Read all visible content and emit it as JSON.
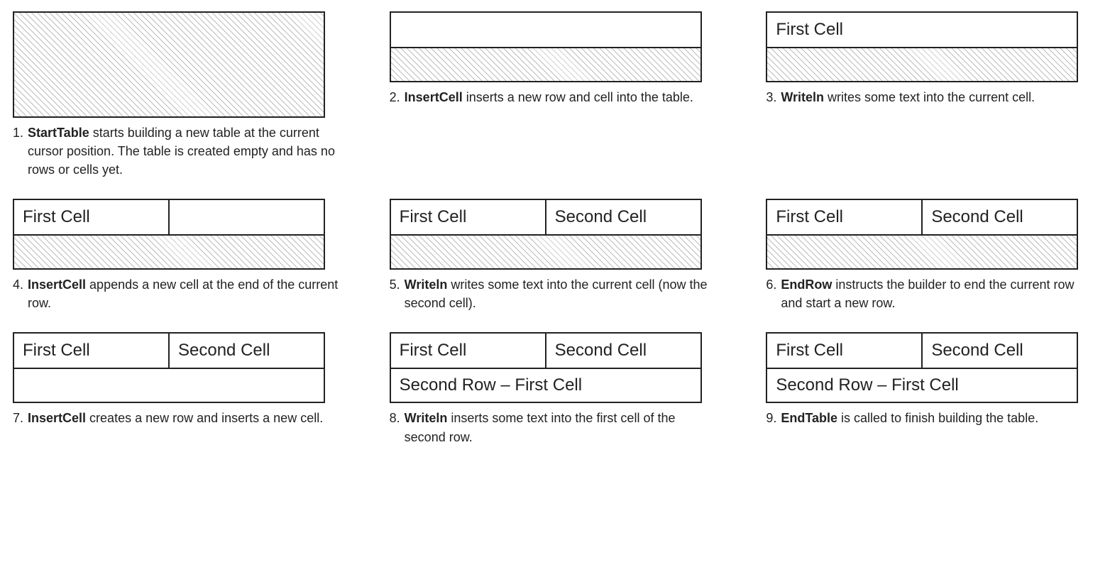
{
  "cells": {
    "first": "First Cell",
    "second": "Second Cell",
    "row2first": "Second Row – First Cell"
  },
  "steps": [
    {
      "num": "1.",
      "bold": "StartTable",
      "rest": " starts building a new table at the current cursor position.",
      "extra": "The table is created empty and has no rows or cells yet."
    },
    {
      "num": "2.",
      "bold": "InsertCell",
      "rest": " inserts a new row and cell into the table."
    },
    {
      "num": "3.",
      "bold": "Writeln",
      "rest": " writes some text into the current cell."
    },
    {
      "num": "4.",
      "bold": "InsertCell",
      "rest": " appends a new cell at the end of the current row."
    },
    {
      "num": "5.",
      "bold": "Writeln",
      "rest": " writes some text into the current cell (now the second cell)."
    },
    {
      "num": "6.",
      "bold": "EndRow",
      "rest": " instructs the builder to end the current row and start a new row."
    },
    {
      "num": "7.",
      "bold": "InsertCell",
      "rest": " creates a new row and inserts a new cell."
    },
    {
      "num": "8.",
      "bold": "Writeln",
      "rest": " inserts some text into the first cell of the second row."
    },
    {
      "num": "9.",
      "bold": "EndTable",
      "rest": " is called to finish building the table."
    }
  ]
}
